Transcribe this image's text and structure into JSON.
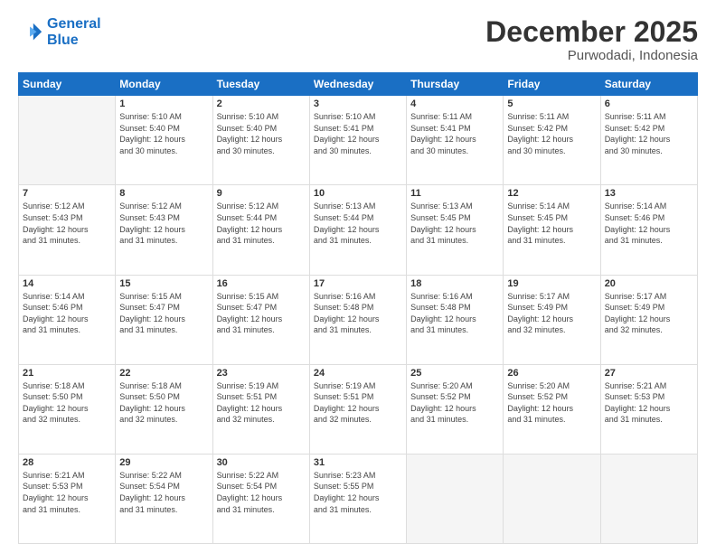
{
  "logo": {
    "line1": "General",
    "line2": "Blue"
  },
  "title": "December 2025",
  "subtitle": "Purwodadi, Indonesia",
  "days_of_week": [
    "Sunday",
    "Monday",
    "Tuesday",
    "Wednesday",
    "Thursday",
    "Friday",
    "Saturday"
  ],
  "weeks": [
    [
      {
        "day": "",
        "info": ""
      },
      {
        "day": "1",
        "info": "Sunrise: 5:10 AM\nSunset: 5:40 PM\nDaylight: 12 hours\nand 30 minutes."
      },
      {
        "day": "2",
        "info": "Sunrise: 5:10 AM\nSunset: 5:40 PM\nDaylight: 12 hours\nand 30 minutes."
      },
      {
        "day": "3",
        "info": "Sunrise: 5:10 AM\nSunset: 5:41 PM\nDaylight: 12 hours\nand 30 minutes."
      },
      {
        "day": "4",
        "info": "Sunrise: 5:11 AM\nSunset: 5:41 PM\nDaylight: 12 hours\nand 30 minutes."
      },
      {
        "day": "5",
        "info": "Sunrise: 5:11 AM\nSunset: 5:42 PM\nDaylight: 12 hours\nand 30 minutes."
      },
      {
        "day": "6",
        "info": "Sunrise: 5:11 AM\nSunset: 5:42 PM\nDaylight: 12 hours\nand 30 minutes."
      }
    ],
    [
      {
        "day": "7",
        "info": "Sunrise: 5:12 AM\nSunset: 5:43 PM\nDaylight: 12 hours\nand 31 minutes."
      },
      {
        "day": "8",
        "info": "Sunrise: 5:12 AM\nSunset: 5:43 PM\nDaylight: 12 hours\nand 31 minutes."
      },
      {
        "day": "9",
        "info": "Sunrise: 5:12 AM\nSunset: 5:44 PM\nDaylight: 12 hours\nand 31 minutes."
      },
      {
        "day": "10",
        "info": "Sunrise: 5:13 AM\nSunset: 5:44 PM\nDaylight: 12 hours\nand 31 minutes."
      },
      {
        "day": "11",
        "info": "Sunrise: 5:13 AM\nSunset: 5:45 PM\nDaylight: 12 hours\nand 31 minutes."
      },
      {
        "day": "12",
        "info": "Sunrise: 5:14 AM\nSunset: 5:45 PM\nDaylight: 12 hours\nand 31 minutes."
      },
      {
        "day": "13",
        "info": "Sunrise: 5:14 AM\nSunset: 5:46 PM\nDaylight: 12 hours\nand 31 minutes."
      }
    ],
    [
      {
        "day": "14",
        "info": "Sunrise: 5:14 AM\nSunset: 5:46 PM\nDaylight: 12 hours\nand 31 minutes."
      },
      {
        "day": "15",
        "info": "Sunrise: 5:15 AM\nSunset: 5:47 PM\nDaylight: 12 hours\nand 31 minutes."
      },
      {
        "day": "16",
        "info": "Sunrise: 5:15 AM\nSunset: 5:47 PM\nDaylight: 12 hours\nand 31 minutes."
      },
      {
        "day": "17",
        "info": "Sunrise: 5:16 AM\nSunset: 5:48 PM\nDaylight: 12 hours\nand 31 minutes."
      },
      {
        "day": "18",
        "info": "Sunrise: 5:16 AM\nSunset: 5:48 PM\nDaylight: 12 hours\nand 31 minutes."
      },
      {
        "day": "19",
        "info": "Sunrise: 5:17 AM\nSunset: 5:49 PM\nDaylight: 12 hours\nand 32 minutes."
      },
      {
        "day": "20",
        "info": "Sunrise: 5:17 AM\nSunset: 5:49 PM\nDaylight: 12 hours\nand 32 minutes."
      }
    ],
    [
      {
        "day": "21",
        "info": "Sunrise: 5:18 AM\nSunset: 5:50 PM\nDaylight: 12 hours\nand 32 minutes."
      },
      {
        "day": "22",
        "info": "Sunrise: 5:18 AM\nSunset: 5:50 PM\nDaylight: 12 hours\nand 32 minutes."
      },
      {
        "day": "23",
        "info": "Sunrise: 5:19 AM\nSunset: 5:51 PM\nDaylight: 12 hours\nand 32 minutes."
      },
      {
        "day": "24",
        "info": "Sunrise: 5:19 AM\nSunset: 5:51 PM\nDaylight: 12 hours\nand 32 minutes."
      },
      {
        "day": "25",
        "info": "Sunrise: 5:20 AM\nSunset: 5:52 PM\nDaylight: 12 hours\nand 31 minutes."
      },
      {
        "day": "26",
        "info": "Sunrise: 5:20 AM\nSunset: 5:52 PM\nDaylight: 12 hours\nand 31 minutes."
      },
      {
        "day": "27",
        "info": "Sunrise: 5:21 AM\nSunset: 5:53 PM\nDaylight: 12 hours\nand 31 minutes."
      }
    ],
    [
      {
        "day": "28",
        "info": "Sunrise: 5:21 AM\nSunset: 5:53 PM\nDaylight: 12 hours\nand 31 minutes."
      },
      {
        "day": "29",
        "info": "Sunrise: 5:22 AM\nSunset: 5:54 PM\nDaylight: 12 hours\nand 31 minutes."
      },
      {
        "day": "30",
        "info": "Sunrise: 5:22 AM\nSunset: 5:54 PM\nDaylight: 12 hours\nand 31 minutes."
      },
      {
        "day": "31",
        "info": "Sunrise: 5:23 AM\nSunset: 5:55 PM\nDaylight: 12 hours\nand 31 minutes."
      },
      {
        "day": "",
        "info": ""
      },
      {
        "day": "",
        "info": ""
      },
      {
        "day": "",
        "info": ""
      }
    ]
  ]
}
